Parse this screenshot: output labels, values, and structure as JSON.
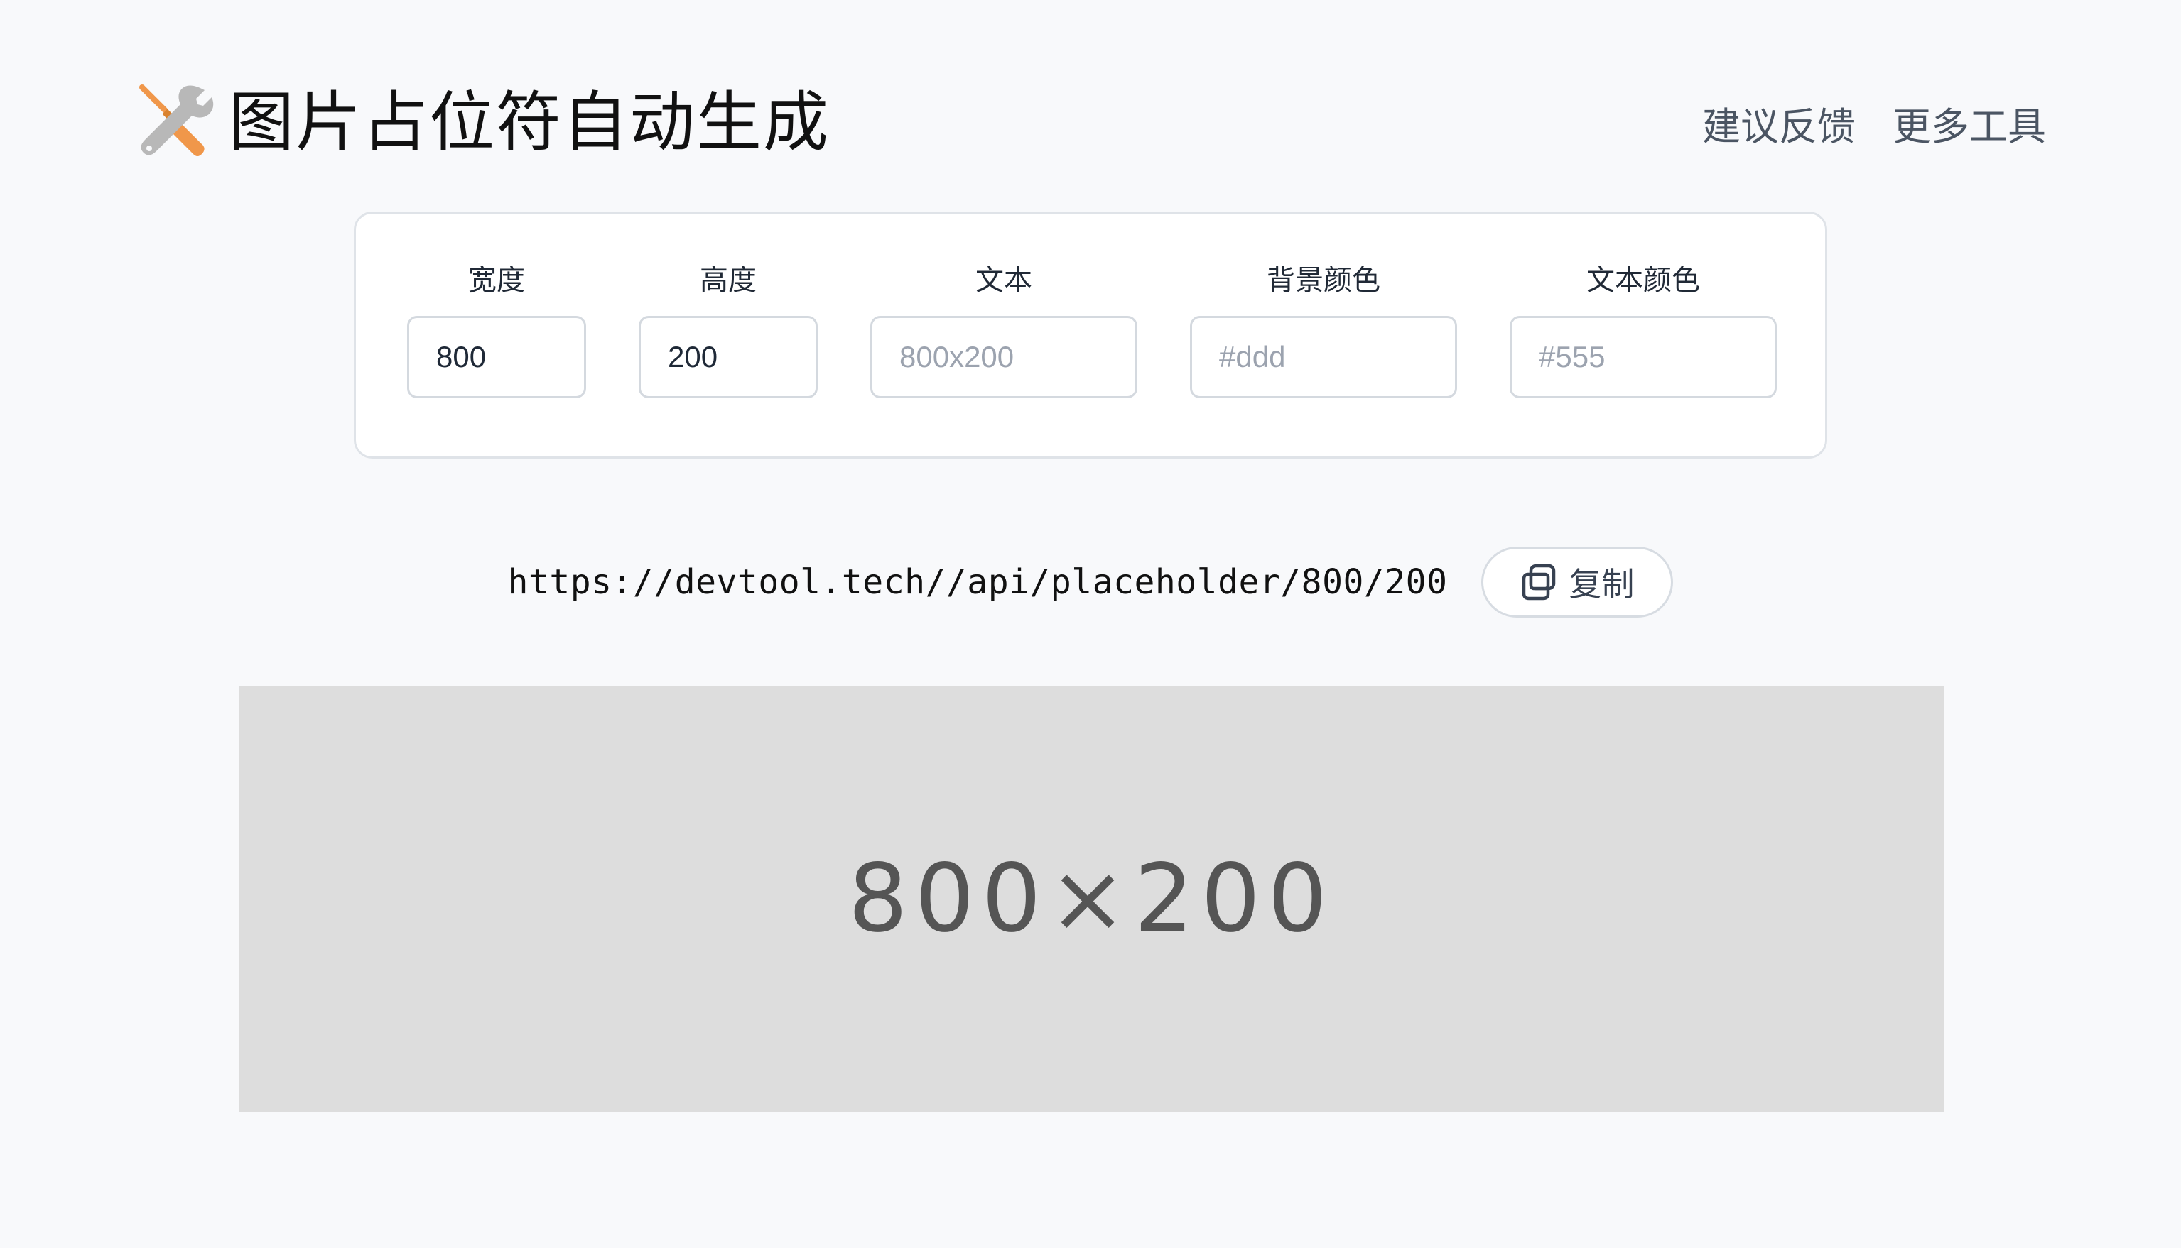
{
  "header": {
    "title": "图片占位符自动生成",
    "logo_icon": "tools-icon",
    "nav": [
      {
        "label": "建议反馈"
      },
      {
        "label": "更多工具"
      }
    ]
  },
  "form": {
    "width": {
      "label": "宽度",
      "value": "800",
      "placeholder": ""
    },
    "height": {
      "label": "高度",
      "value": "200",
      "placeholder": ""
    },
    "text": {
      "label": "文本",
      "value": "",
      "placeholder": "800x200"
    },
    "bg_color": {
      "label": "背景颜色",
      "value": "",
      "placeholder": "#ddd"
    },
    "text_color": {
      "label": "文本颜色",
      "value": "",
      "placeholder": "#555"
    }
  },
  "url_row": {
    "url": "https://devtool.tech//api/placeholder/800/200",
    "copy_label": "复制",
    "copy_icon": "copy-icon"
  },
  "preview": {
    "text": "800×200",
    "background": "#dddddd",
    "text_color": "#555555"
  },
  "colors": {
    "page_background": "#f8f9fb",
    "brand_orange": "#f0974a",
    "icon_gray": "#b8b8b8",
    "nav_text": "#4b5563"
  }
}
